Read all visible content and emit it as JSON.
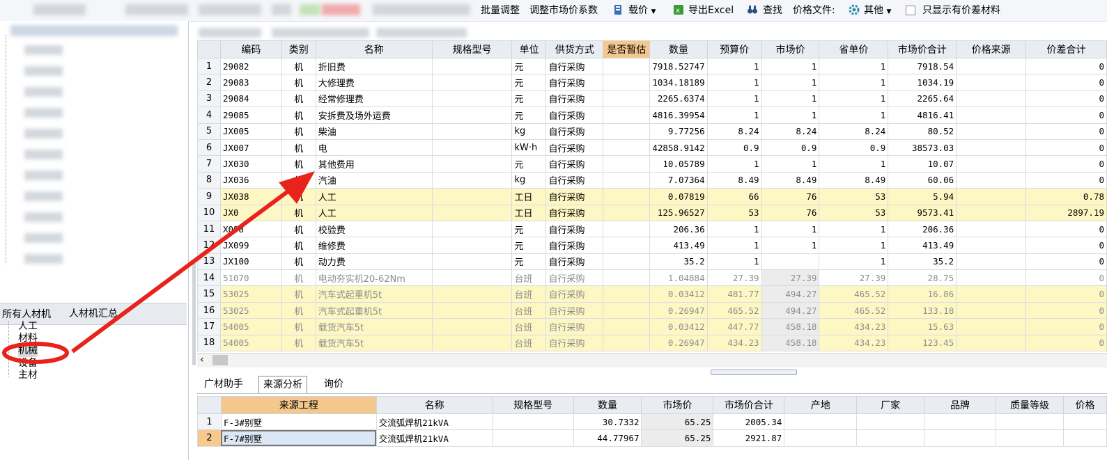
{
  "toolbar": {
    "batch_adjust": "批量调整",
    "adjust_market_coef": "调整市场价系数",
    "load_price": "载价",
    "export_excel": "导出Excel",
    "search": "查找",
    "price_file": "价格文件:",
    "other": "其他",
    "only_show_diff": "只显示有价差材料"
  },
  "left": {
    "panel_title": "人材机汇总",
    "tree_root": "所有人材机",
    "tree_items": [
      "人工",
      "材料",
      "机械",
      "设备",
      "主材"
    ]
  },
  "grid": {
    "headers": [
      "",
      "编码",
      "类别",
      "名称",
      "规格型号",
      "单位",
      "供货方式",
      "是否暂估",
      "数量",
      "预算价",
      "市场价",
      "省单价",
      "市场价合计",
      "价格来源",
      "价差合计"
    ],
    "rows": [
      {
        "n": "1",
        "code": "29082",
        "cat": "机",
        "name": "折旧费",
        "spec": "",
        "unit": "元",
        "supply": "自行采购",
        "est": "",
        "qty": "7918.52747",
        "budget": "1",
        "market": "1",
        "prov": "1",
        "total": "7918.54",
        "src": "",
        "diff": "0"
      },
      {
        "n": "2",
        "code": "29083",
        "cat": "机",
        "name": "大修理费",
        "spec": "",
        "unit": "元",
        "supply": "自行采购",
        "est": "",
        "qty": "1034.18189",
        "budget": "1",
        "market": "1",
        "prov": "1",
        "total": "1034.19",
        "src": "",
        "diff": "0"
      },
      {
        "n": "3",
        "code": "29084",
        "cat": "机",
        "name": "经常修理费",
        "spec": "",
        "unit": "元",
        "supply": "自行采购",
        "est": "",
        "qty": "2265.6374",
        "budget": "1",
        "market": "1",
        "prov": "1",
        "total": "2265.64",
        "src": "",
        "diff": "0"
      },
      {
        "n": "4",
        "code": "29085",
        "cat": "机",
        "name": "安拆费及场外运费",
        "spec": "",
        "unit": "元",
        "supply": "自行采购",
        "est": "",
        "qty": "4816.39954",
        "budget": "1",
        "market": "1",
        "prov": "1",
        "total": "4816.41",
        "src": "",
        "diff": "0"
      },
      {
        "n": "5",
        "code": "JX005",
        "cat": "机",
        "name": "柴油",
        "spec": "",
        "unit": "kg",
        "supply": "自行采购",
        "est": "",
        "qty": "9.77256",
        "budget": "8.24",
        "market": "8.24",
        "prov": "8.24",
        "total": "80.52",
        "src": "",
        "diff": "0"
      },
      {
        "n": "6",
        "code": "JX007",
        "cat": "机",
        "name": "电",
        "spec": "",
        "unit": "kW·h",
        "supply": "自行采购",
        "est": "",
        "qty": "42858.9142",
        "budget": "0.9",
        "market": "0.9",
        "prov": "0.9",
        "total": "38573.03",
        "src": "",
        "diff": "0"
      },
      {
        "n": "7",
        "code": "JX030",
        "cat": "机",
        "name": "其他费用",
        "spec": "",
        "unit": "元",
        "supply": "自行采购",
        "est": "",
        "qty": "10.05789",
        "budget": "1",
        "market": "1",
        "prov": "1",
        "total": "10.07",
        "src": "",
        "diff": "0"
      },
      {
        "n": "8",
        "code": "JX036",
        "cat": "机",
        "name": "汽油",
        "spec": "",
        "unit": "kg",
        "supply": "自行采购",
        "est": "",
        "qty": "7.07364",
        "budget": "8.49",
        "market": "8.49",
        "prov": "8.49",
        "total": "60.06",
        "src": "",
        "diff": "0"
      },
      {
        "n": "9",
        "code": "JX038",
        "cat": "机",
        "name": "人工",
        "spec": "",
        "unit": "工日",
        "supply": "自行采购",
        "est": "",
        "qty": "0.07819",
        "budget": "66",
        "market": "76",
        "prov": "53",
        "total": "5.94",
        "src": "",
        "diff": "0.78"
      },
      {
        "n": "10",
        "code": "JX0",
        "cat": "机",
        "name": "人工",
        "spec": "",
        "unit": "工日",
        "supply": "自行采购",
        "est": "",
        "qty": "125.96527",
        "budget": "53",
        "market": "76",
        "prov": "53",
        "total": "9573.41",
        "src": "",
        "diff": "2897.19"
      },
      {
        "n": "11",
        "code": "X098",
        "cat": "机",
        "name": "校验费",
        "spec": "",
        "unit": "元",
        "supply": "自行采购",
        "est": "",
        "qty": "206.36",
        "budget": "1",
        "market": "1",
        "prov": "1",
        "total": "206.36",
        "src": "",
        "diff": "0"
      },
      {
        "n": "12",
        "code": "JX099",
        "cat": "机",
        "name": "维修费",
        "spec": "",
        "unit": "元",
        "supply": "自行采购",
        "est": "",
        "qty": "413.49",
        "budget": "1",
        "market": "1",
        "prov": "1",
        "total": "413.49",
        "src": "",
        "diff": "0"
      },
      {
        "n": "13",
        "code": "JX100",
        "cat": "机",
        "name": "动力费",
        "spec": "",
        "unit": "元",
        "supply": "自行采购",
        "est": "",
        "qty": "35.2",
        "budget": "1",
        "market": "",
        "prov": "1",
        "total": "35.2",
        "src": "",
        "diff": "0"
      },
      {
        "n": "14",
        "code": "51070",
        "cat": "机",
        "name": "电动夯实机20-62Nm",
        "spec": "",
        "unit": "台班",
        "supply": "自行采购",
        "est": "",
        "qty": "1.04884",
        "budget": "27.39",
        "market": "27.39",
        "prov": "27.39",
        "total": "28.75",
        "src": "",
        "diff": "0"
      },
      {
        "n": "15",
        "code": "53025",
        "cat": "机",
        "name": "汽车式起重机5t",
        "spec": "",
        "unit": "台班",
        "supply": "自行采购",
        "est": "",
        "qty": "0.03412",
        "budget": "481.77",
        "market": "494.27",
        "prov": "465.52",
        "total": "16.86",
        "src": "",
        "diff": "0"
      },
      {
        "n": "16",
        "code": "53025",
        "cat": "机",
        "name": "汽车式起重机5t",
        "spec": "",
        "unit": "台班",
        "supply": "自行采购",
        "est": "",
        "qty": "0.26947",
        "budget": "465.52",
        "market": "494.27",
        "prov": "465.52",
        "total": "133.18",
        "src": "",
        "diff": "0"
      },
      {
        "n": "17",
        "code": "54005",
        "cat": "机",
        "name": "载货汽车5t",
        "spec": "",
        "unit": "台班",
        "supply": "自行采购",
        "est": "",
        "qty": "0.03412",
        "budget": "447.77",
        "market": "458.18",
        "prov": "434.23",
        "total": "15.63",
        "src": "",
        "diff": "0"
      },
      {
        "n": "18",
        "code": "54005",
        "cat": "机",
        "name": "载货汽车5t",
        "spec": "",
        "unit": "台班",
        "supply": "自行采购",
        "est": "",
        "qty": "0.26947",
        "budget": "434.23",
        "market": "458.18",
        "prov": "434.23",
        "total": "123.45",
        "src": "",
        "diff": "0"
      }
    ]
  },
  "tabs": [
    "广材助手",
    "来源分析",
    "询价"
  ],
  "source": {
    "headers": [
      "",
      "来源工程",
      "名称",
      "规格型号",
      "数量",
      "市场价",
      "市场价合计",
      "产地",
      "厂家",
      "品牌",
      "质量等级",
      "价格"
    ],
    "rows": [
      {
        "n": "1",
        "proj": "F-3#别墅",
        "name": "交流弧焊机21kVA",
        "spec": "",
        "qty": "30.7332",
        "market": "65.25",
        "total": "2005.34"
      },
      {
        "n": "2",
        "proj": "F-7#别墅",
        "name": "交流弧焊机21kVA",
        "spec": "",
        "qty": "44.77967",
        "market": "65.25",
        "total": "2921.87"
      }
    ]
  }
}
